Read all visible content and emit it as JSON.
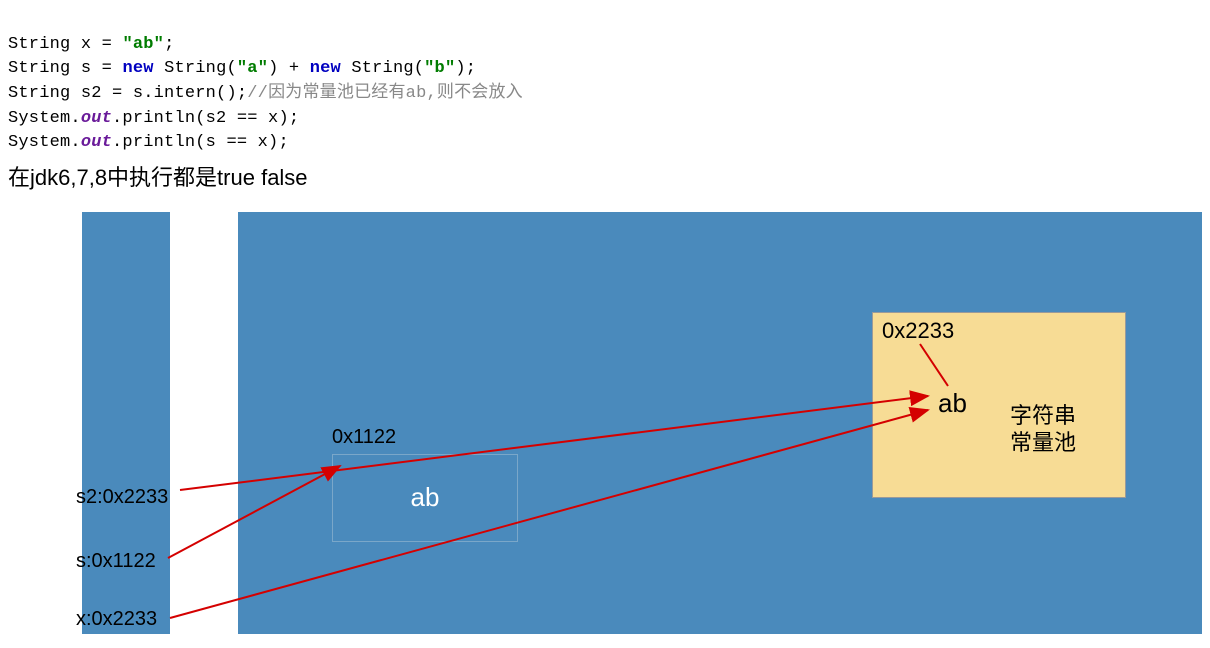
{
  "code": {
    "line1": {
      "type": "String",
      "var": "x",
      "eq": " = ",
      "str": "\"ab\"",
      "end": ";"
    },
    "line2": {
      "type": "String",
      "var": "s",
      "eq": " = ",
      "kw1": "new",
      "sp1": " String(",
      "str1": "\"a\"",
      "mid": ") + ",
      "kw2": "new",
      "sp2": " String(",
      "str2": "\"b\"",
      "end": ");"
    },
    "line3": {
      "type": "String",
      "var": "s2",
      "eq": " = s.intern();",
      "comment": "//因为常量池已经有ab,则不会放入"
    },
    "line4": {
      "pre": "System.",
      "out": "out",
      "rest": ".println(s2 == x);"
    },
    "line5": {
      "pre": "System.",
      "out": "out",
      "rest": ".println(s == x);"
    }
  },
  "caption": "在jdk6,7,8中执行都是true  false",
  "diagram": {
    "vars": {
      "s2": "s2:0x2233",
      "s": "s:0x1122",
      "x": "x:0x2233"
    },
    "heap_addr": "0x1122",
    "heap_val": "ab",
    "pool_addr": "0x2233",
    "pool_val": "ab",
    "pool_label_l1": "字符串",
    "pool_label_l2": "常量池"
  }
}
